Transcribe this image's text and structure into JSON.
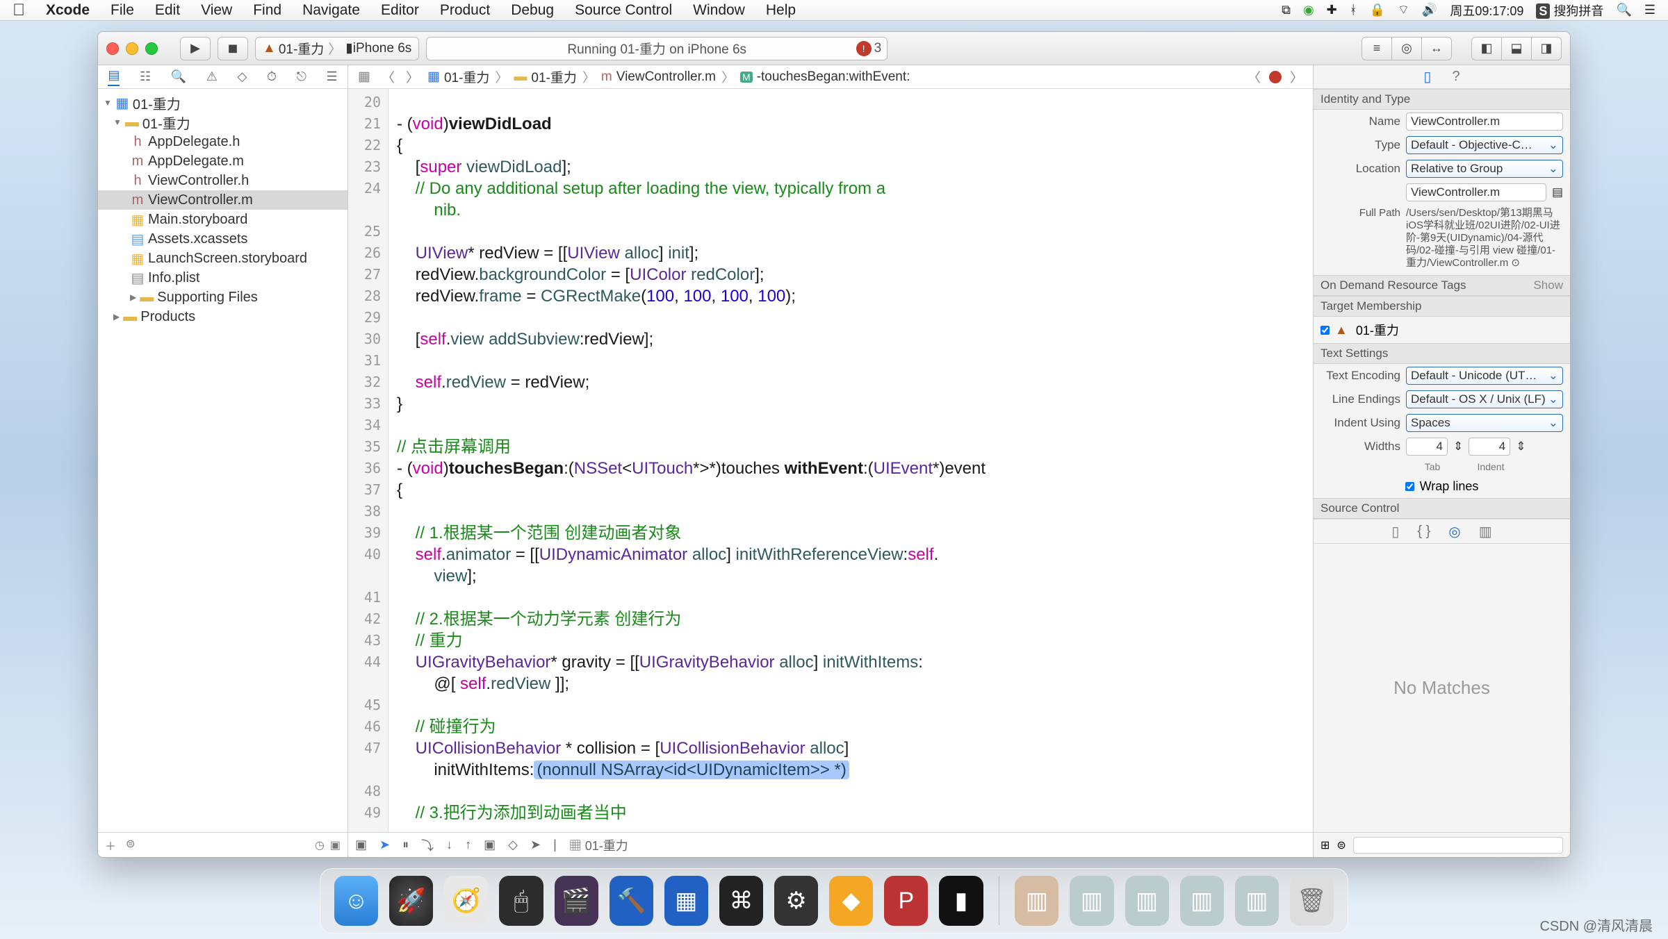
{
  "menubar": {
    "app": "Xcode",
    "items": [
      "File",
      "Edit",
      "View",
      "Find",
      "Navigate",
      "Editor",
      "Product",
      "Debug",
      "Source Control",
      "Window",
      "Help"
    ],
    "clock": "周五09:17:09",
    "ime": "搜狗拼音"
  },
  "toolbar": {
    "scheme_target": "01-重力",
    "scheme_device": "iPhone 6s",
    "activity": "Running 01-重力 on iPhone 6s",
    "warn_count": "3"
  },
  "navigator": {
    "project": "01-重力",
    "group": "01-重力",
    "files": [
      "AppDelegate.h",
      "AppDelegate.m",
      "ViewController.h",
      "ViewController.m",
      "Main.storyboard",
      "Assets.xcassets",
      "LaunchScreen.storyboard",
      "Info.plist"
    ],
    "supporting": "Supporting Files",
    "products": "Products",
    "selected": "ViewController.m"
  },
  "jumpbar": {
    "c1": "01-重力",
    "c2": "01-重力",
    "c3": "ViewController.m",
    "c4": "-touchesBegan:withEvent:"
  },
  "code": {
    "lines_start": 20,
    "lines_end": 49,
    "l21a": "- (",
    "l21b": "void",
    "l21c": ")",
    "l21d": "viewDidLoad",
    "l22": "{",
    "l23a": "    [",
    "l23b": "super",
    "l23c": " ",
    "l23d": "viewDidLoad",
    "l23e": "];",
    "l24a": "    // Do any additional setup after loading the view, typically from a",
    "l24b": "        nib.",
    "l26a": "    ",
    "l26b": "UIView",
    "l26c": "* redView = [[",
    "l26d": "UIView",
    "l26e": " ",
    "l26f": "alloc",
    "l26g": "] ",
    "l26h": "init",
    "l26i": "];",
    "l27a": "    redView.",
    "l27b": "backgroundColor",
    "l27c": " = [",
    "l27d": "UIColor",
    "l27e": " ",
    "l27f": "redColor",
    "l27g": "];",
    "l28a": "    redView.",
    "l28b": "frame",
    "l28c": " = ",
    "l28d": "CGRectMake",
    "l28e": "(",
    "l28f": "100",
    "l28g": ", ",
    "l28h": "100",
    "l28i": ", ",
    "l28j": "100",
    "l28k": ", ",
    "l28l": "100",
    "l28m": ");",
    "l30a": "    [",
    "l30b": "self",
    "l30c": ".",
    "l30d": "view",
    "l30e": " ",
    "l30f": "addSubview",
    "l30g": ":redView];",
    "l32a": "    ",
    "l32b": "self",
    "l32c": ".",
    "l32d": "redView",
    "l32e": " = redView;",
    "l33": "}",
    "l35": "// 点击屏幕调用",
    "l36a": "- (",
    "l36b": "void",
    "l36c": ")",
    "l36d": "touchesBegan",
    "l36e": ":(",
    "l36f": "NSSet",
    "l36g": "<",
    "l36h": "UITouch",
    "l36i": "*>*)touches ",
    "l36j": "withEvent",
    "l36k": ":(",
    "l36l": "UIEvent",
    "l36m": "*)event",
    "l37": "{",
    "l39": "    // 1.根据某一个范围 创建动画者对象",
    "l40a": "    ",
    "l40b": "self",
    "l40c": ".",
    "l40d": "animator",
    "l40e": " = [[",
    "l40f": "UIDynamicAnimator",
    "l40g": " ",
    "l40h": "alloc",
    "l40i": "] ",
    "l40j": "initWithReferenceView",
    "l40k": ":",
    "l40l": "self",
    "l40m": ".",
    "l40n": "        view",
    "l40o": "];",
    "l42": "    // 2.根据某一个动力学元素 创建行为",
    "l43": "    // 重力",
    "l44a": "    ",
    "l44b": "UIGravityBehavior",
    "l44c": "* gravity = [[",
    "l44d": "UIGravityBehavior",
    "l44e": " ",
    "l44f": "alloc",
    "l44g": "] ",
    "l44h": "initWithItems",
    "l44i": ":",
    "l44j": "        @[ ",
    "l44k": "self",
    "l44l": ".",
    "l44m": "redView",
    "l44n": " ]];",
    "l46": "    // 碰撞行为",
    "l47a": "    ",
    "l47b": "UICollisionBehavior",
    "l47c": " * collision = [",
    "l47d": "UICollisionBehavior",
    "l47e": " ",
    "l47f": "alloc",
    "l47g": "]",
    "l47h": "        initWithItems:",
    "l47ph": "(nonnull NSArray<id<UIDynamicItem>> *)",
    "l49": "    // 3.把行为添加到动画者当中"
  },
  "debugbar": {
    "scheme": "01-重力"
  },
  "inspector": {
    "identity_hd": "Identity and Type",
    "name_lbl": "Name",
    "name_val": "ViewController.m",
    "type_lbl": "Type",
    "type_val": "Default - Objective-C…",
    "loc_lbl": "Location",
    "loc_val": "Relative to Group",
    "loc_sub": "ViewController.m",
    "fullpath_lbl": "Full Path",
    "fullpath_val": "/Users/sen/Desktop/第13期黑马iOS学科就业班/02UI进阶/02-UI进阶-第9天(UIDynamic)/04-源代码/02-碰撞-与引用 view 碰撞/01-重力/ViewController.m  ⊙",
    "odr_hd": "On Demand Resource Tags",
    "odr_show": "Show",
    "tm_hd": "Target Membership",
    "tm_item": "01-重力",
    "ts_hd": "Text Settings",
    "enc_lbl": "Text Encoding",
    "enc_val": "Default - Unicode (UT…",
    "le_lbl": "Line Endings",
    "le_val": "Default - OS X / Unix (LF)",
    "iu_lbl": "Indent Using",
    "iu_val": "Spaces",
    "w_lbl": "Widths",
    "w_tab": "4",
    "w_ind": "4",
    "w_tab_lbl": "Tab",
    "w_ind_lbl": "Indent",
    "wrap_lbl": "Wrap lines",
    "sc_hd": "Source Control",
    "nomatch": "No Matches"
  },
  "watermark": "CSDN @清风清晨"
}
